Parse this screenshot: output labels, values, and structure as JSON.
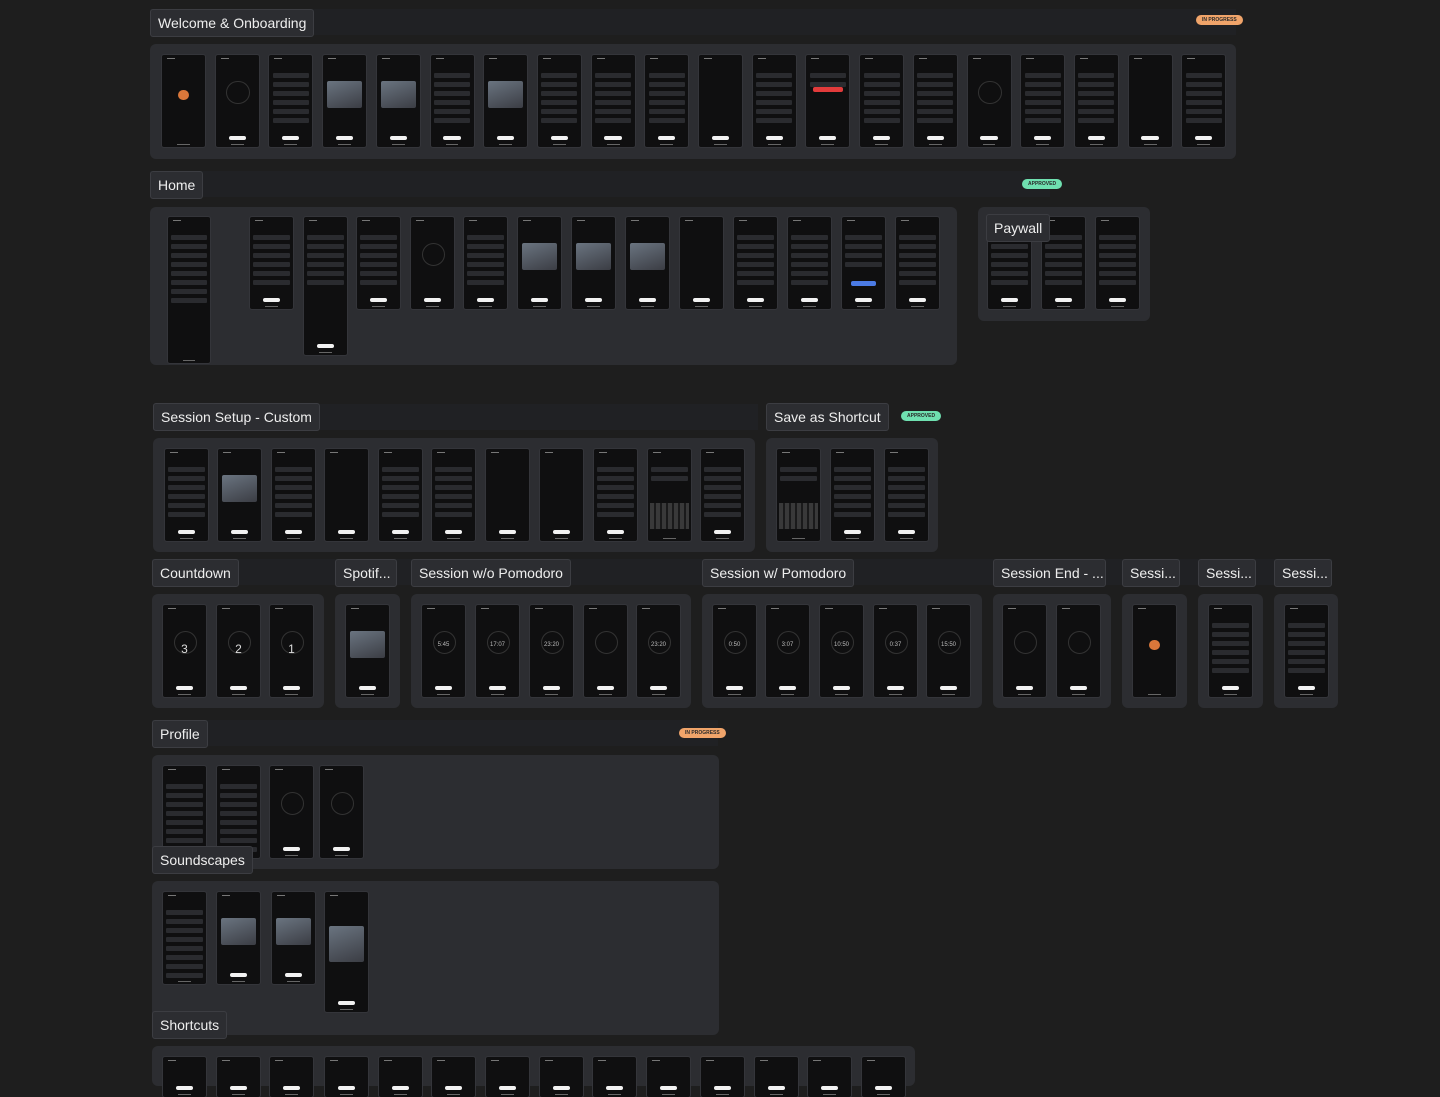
{
  "board": {
    "background": "#1e1e1e",
    "panel_color": "#2c2d31",
    "badge_colors": {
      "orange": "#f0a46a",
      "green": "#6fe0b0"
    }
  },
  "sections": {
    "welcome": {
      "label": "Welcome & Onboarding",
      "badge": "IN PROGRESS"
    },
    "home": {
      "label": "Home",
      "badge": "APPROVED"
    },
    "paywall": {
      "label": "Paywall"
    },
    "session_setup": {
      "label": "Session Setup - Custom"
    },
    "save_shortcut": {
      "label": "Save as Shortcut",
      "badge": "APPROVED"
    },
    "countdown": {
      "label": "Countdown",
      "digits": [
        "3",
        "2",
        "1"
      ]
    },
    "spotify": {
      "label": "Spotif..."
    },
    "session_wo": {
      "label": "Session w/o Pomodoro",
      "times": [
        "5:45",
        "17:07",
        "23:20",
        "",
        "23:20"
      ]
    },
    "session_w": {
      "label": "Session w/ Pomodoro",
      "times": [
        "0:50",
        "3:07",
        "10:50",
        "0:37",
        "15:50"
      ]
    },
    "session_end": {
      "label": "Session End - ..."
    },
    "sessi_1": {
      "label": "Sessi..."
    },
    "sessi_2": {
      "label": "Sessi..."
    },
    "sessi_3": {
      "label": "Sessi..."
    },
    "profile": {
      "label": "Profile",
      "badge": "IN PROGRESS"
    },
    "soundscapes": {
      "label": "Soundscapes"
    },
    "shortcuts": {
      "label": "Shortcuts"
    }
  }
}
